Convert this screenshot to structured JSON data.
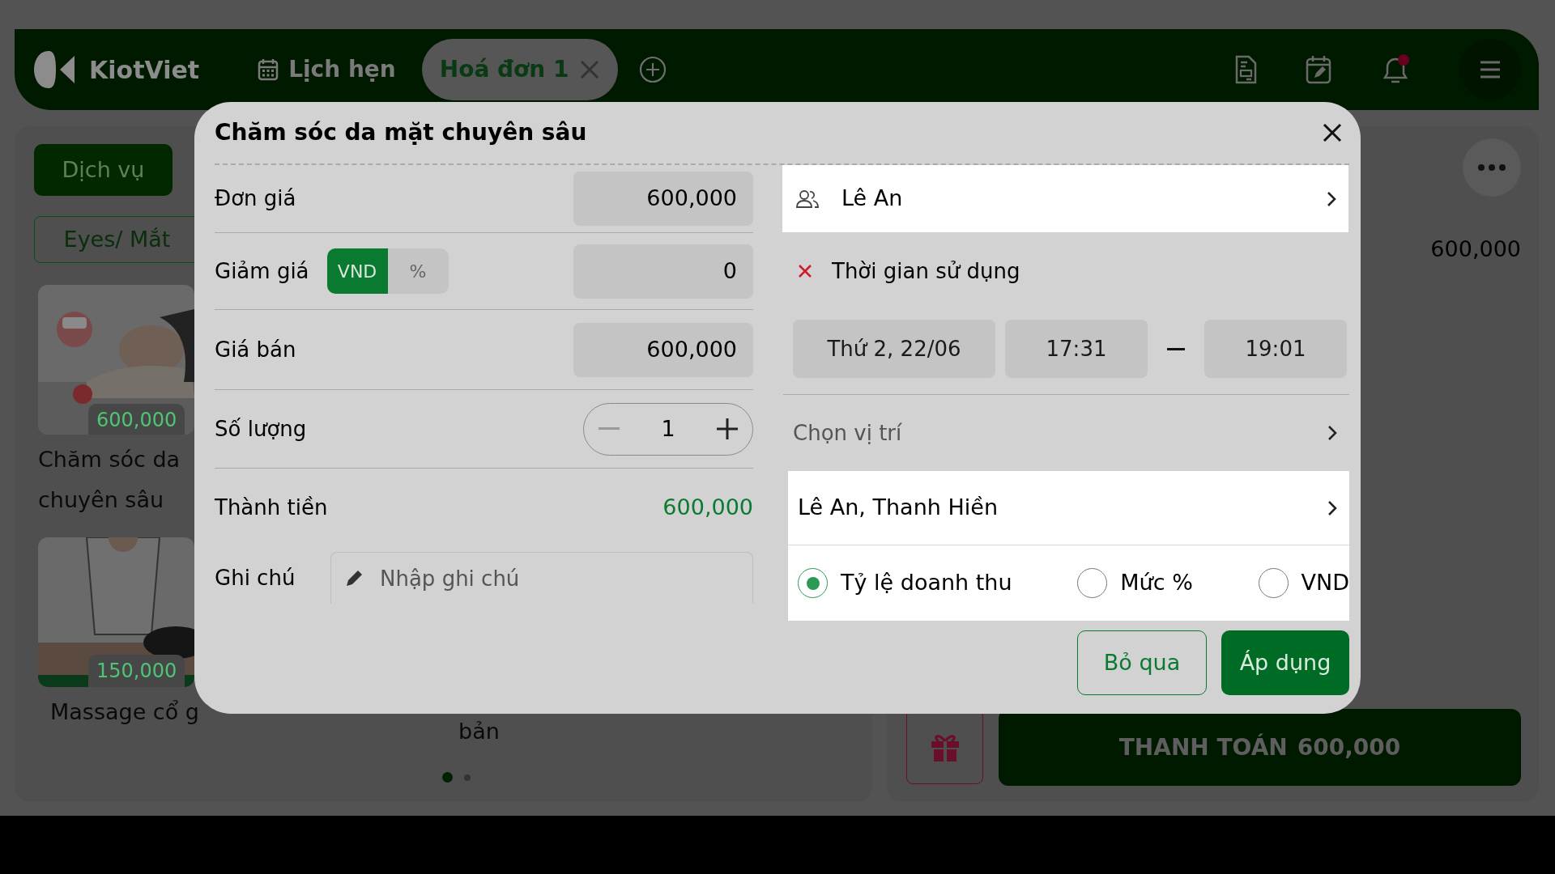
{
  "header": {
    "logo_text": "KiotViet",
    "tabs": [
      {
        "label": "Lịch hẹn",
        "kind": "schedule",
        "selected": false
      },
      {
        "label": "Hoá đơn 1",
        "kind": "invoice",
        "selected": true
      }
    ],
    "bell_unread": true
  },
  "catalog": {
    "categories": [
      {
        "label": "Dịch vụ",
        "selected": true
      }
    ],
    "filters": [
      {
        "label": "Eyes/ Mắt"
      }
    ],
    "products": [
      {
        "price": "600,000",
        "name_lines": [
          "Chăm sóc da",
          "chuyên sâu"
        ],
        "picture": {
          "kind": "picture"
        }
      },
      {
        "price": "150,000",
        "name_lines": [
          "Massage cổ g"
        ],
        "picture": {
          "kind": "picture"
        }
      }
    ],
    "hidden_name_tail": "bản",
    "pager": [
      {
        "selected": true
      },
      {
        "selected": false
      }
    ]
  },
  "order": {
    "total": "600,000",
    "checkout": {
      "label": "THANH TOÁN",
      "amount": "600,000"
    }
  },
  "modal": {
    "title": "Chăm sóc da mặt chuyên sâu",
    "unit_price": {
      "label": "Đơn giá",
      "value": "600,000"
    },
    "discount": {
      "label": "Giảm giá",
      "units": [
        {
          "label": "VND",
          "selected": true
        },
        {
          "label": "%",
          "selected": false
        }
      ],
      "value": "0"
    },
    "sale_price": {
      "label": "Giá bán",
      "value": "600,000"
    },
    "quantity": {
      "label": "Số lượng",
      "value": "1",
      "decrease_disabled": true
    },
    "amount": {
      "label": "Thành tiền",
      "value": "600,000"
    },
    "note": {
      "label": "Ghi chú",
      "placeholder": "Nhập ghi chú"
    },
    "customer": {
      "name": "Lê An"
    },
    "usage_time": {
      "label": "Thời gian sử dụng",
      "date": "Thứ 2, 22/06",
      "start": "17:31",
      "end": "19:01"
    },
    "location": {
      "placeholder": "Chọn vị trí"
    },
    "staff": {
      "value": "Lê An, Thanh Hiền"
    },
    "commission_modes": [
      {
        "label": "Tỷ lệ doanh thu",
        "selected": true
      },
      {
        "label": "Mức %",
        "selected": false
      },
      {
        "label": "VND",
        "selected": false
      }
    ],
    "buttons": [
      {
        "label": "Bỏ qua",
        "kind": "outline"
      },
      {
        "label": "Áp dụng",
        "kind": "primary"
      }
    ]
  }
}
